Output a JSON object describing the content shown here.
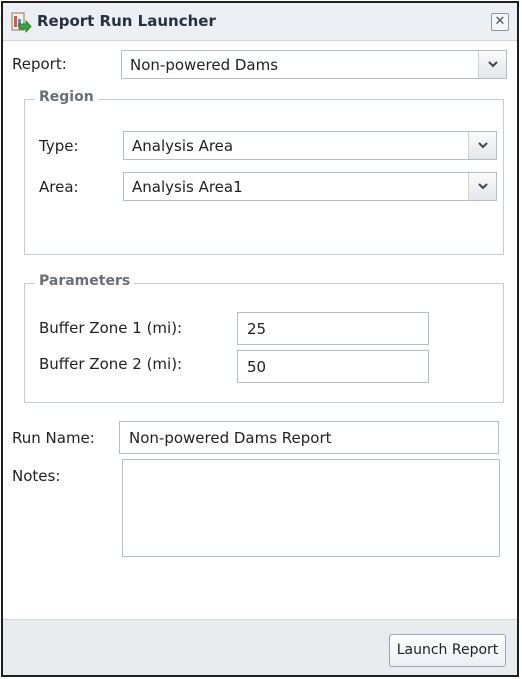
{
  "window": {
    "title": "Report Run Launcher",
    "close_glyph": "✕",
    "title_icon": "report-launch-icon",
    "close_icon": "close-icon"
  },
  "report": {
    "label": "Report:",
    "value": "Non-powered Dams"
  },
  "region": {
    "legend": "Region",
    "type_label": "Type:",
    "type_value": "Analysis Area",
    "area_label": "Area:",
    "area_value": "Analysis Area1"
  },
  "parameters": {
    "legend": "Parameters",
    "buffer1_label": "Buffer Zone 1 (mi):",
    "buffer1_value": "25",
    "buffer2_label": "Buffer Zone 2 (mi):",
    "buffer2_value": "50"
  },
  "run": {
    "name_label": "Run Name:",
    "name_value": "Non-powered Dams Report",
    "notes_label": "Notes:",
    "notes_value": ""
  },
  "footer": {
    "launch_label": "Launch Report"
  },
  "icons": {
    "dropdown": "chevron-down-icon"
  },
  "colors": {
    "titlebar_bg": "#eceff3",
    "footer_bg": "#e9ebee",
    "border": "#b5bcc4",
    "legend_text": "#6a6f75"
  }
}
